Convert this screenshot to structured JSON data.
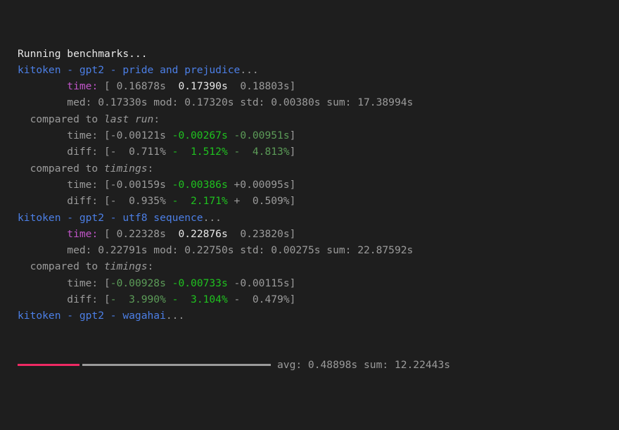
{
  "colors": {
    "background": "#1e1e1e",
    "text": "#9b9b9b",
    "highlight": "#e8e8e8",
    "bench_title": "#4c7fe6",
    "time_label": "#c055c8",
    "improved": "#1fc21f",
    "improved_dim": "#5c9c58",
    "progress": "#ee2a64"
  },
  "lines": [
    [
      {
        "t": "Running benchmarks...",
        "c": "white"
      }
    ],
    [
      {
        "t": "kitoken - gpt2 - pride and prejudice",
        "c": "blue"
      },
      {
        "t": "...",
        "c": "gray"
      }
    ],
    [
      {
        "t": "        ",
        "c": "gray"
      },
      {
        "t": "time:",
        "c": "magenta"
      },
      {
        "t": " [ 0.16878s  ",
        "c": "gray"
      },
      {
        "t": "0.17390s",
        "c": "white"
      },
      {
        "t": "  0.18803s]",
        "c": "gray"
      }
    ],
    [
      {
        "t": "        med: 0.17330s mod: 0.17320s std: 0.00380s sum: 17.38994s",
        "c": "gray"
      }
    ],
    [
      {
        "t": "  compared to ",
        "c": "gray"
      },
      {
        "t": "last run",
        "c": "gray",
        "i": true
      },
      {
        "t": ":",
        "c": "gray"
      }
    ],
    [
      {
        "t": "        time: [-0.00121s ",
        "c": "gray"
      },
      {
        "t": "-0.00267s",
        "c": "green"
      },
      {
        "t": " ",
        "c": "gray"
      },
      {
        "t": "-0.00951s",
        "c": "dimgreen"
      },
      {
        "t": "]",
        "c": "gray"
      }
    ],
    [
      {
        "t": "        diff: [-  0.711% ",
        "c": "gray"
      },
      {
        "t": "-  1.512%",
        "c": "green"
      },
      {
        "t": " ",
        "c": "gray"
      },
      {
        "t": "-  4.813%",
        "c": "dimgreen"
      },
      {
        "t": "]",
        "c": "gray"
      }
    ],
    [
      {
        "t": "  compared to ",
        "c": "gray"
      },
      {
        "t": "timings",
        "c": "gray",
        "i": true
      },
      {
        "t": ":",
        "c": "gray"
      }
    ],
    [
      {
        "t": "        time: [-0.00159s ",
        "c": "gray"
      },
      {
        "t": "-0.00386s",
        "c": "green"
      },
      {
        "t": " +0.00095s]",
        "c": "gray"
      }
    ],
    [
      {
        "t": "        diff: [-  0.935% ",
        "c": "gray"
      },
      {
        "t": "-  2.171%",
        "c": "green"
      },
      {
        "t": " +  0.509%]",
        "c": "gray"
      }
    ],
    [
      {
        "t": "kitoken - gpt2 - utf8 sequence",
        "c": "blue"
      },
      {
        "t": "...",
        "c": "gray"
      }
    ],
    [
      {
        "t": "        ",
        "c": "gray"
      },
      {
        "t": "time:",
        "c": "magenta"
      },
      {
        "t": " [ 0.22328s  ",
        "c": "gray"
      },
      {
        "t": "0.22876s",
        "c": "white"
      },
      {
        "t": "  0.23820s]",
        "c": "gray"
      }
    ],
    [
      {
        "t": "        med: 0.22791s mod: 0.22750s std: 0.00275s sum: 22.87592s",
        "c": "gray"
      }
    ],
    [
      {
        "t": "  compared to ",
        "c": "gray"
      },
      {
        "t": "timings",
        "c": "gray",
        "i": true
      },
      {
        "t": ":",
        "c": "gray"
      }
    ],
    [
      {
        "t": "        time: [",
        "c": "gray"
      },
      {
        "t": "-0.00928s",
        "c": "dimgreen"
      },
      {
        "t": " ",
        "c": "gray"
      },
      {
        "t": "-0.00733s",
        "c": "green"
      },
      {
        "t": " -0.00115s]",
        "c": "gray"
      }
    ],
    [
      {
        "t": "        diff: [",
        "c": "gray"
      },
      {
        "t": "-  3.990%",
        "c": "dimgreen"
      },
      {
        "t": " ",
        "c": "gray"
      },
      {
        "t": "-  3.104%",
        "c": "green"
      },
      {
        "t": " -  0.479%]",
        "c": "gray"
      }
    ],
    [
      {
        "t": "kitoken - gpt2 - wagahai",
        "c": "blue"
      },
      {
        "t": "...",
        "c": "gray"
      }
    ]
  ],
  "progress": {
    "fraction": 0.25,
    "stats": "avg: 0.48898s sum: 12.22443s"
  }
}
